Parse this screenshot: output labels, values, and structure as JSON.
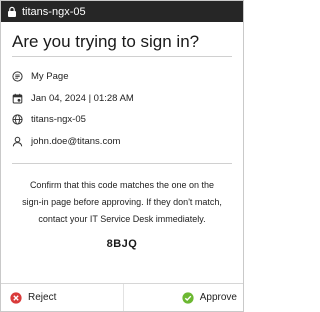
{
  "titlebar": {
    "title": "titans-ngx-05",
    "icon": "lock-icon"
  },
  "heading": "Are you trying to sign in?",
  "details": [
    {
      "icon": "app-icon",
      "text": "My Page"
    },
    {
      "icon": "calendar-icon",
      "text": "Jan 04, 2024 | 01:28 AM"
    },
    {
      "icon": "globe-icon",
      "text": "titans-ngx-05"
    },
    {
      "icon": "user-icon",
      "text": "john.doe@titans.com"
    }
  ],
  "message": "Confirm that this code matches the one on the sign-in page before approving. If they don't match, contact your IT Service Desk immediately.",
  "code": "8BJQ",
  "footer": {
    "reject_label": "Reject",
    "approve_label": "Approve"
  },
  "colors": {
    "titlebar": "#262626",
    "reject": "#d93a3a",
    "approve": "#6cb832"
  }
}
